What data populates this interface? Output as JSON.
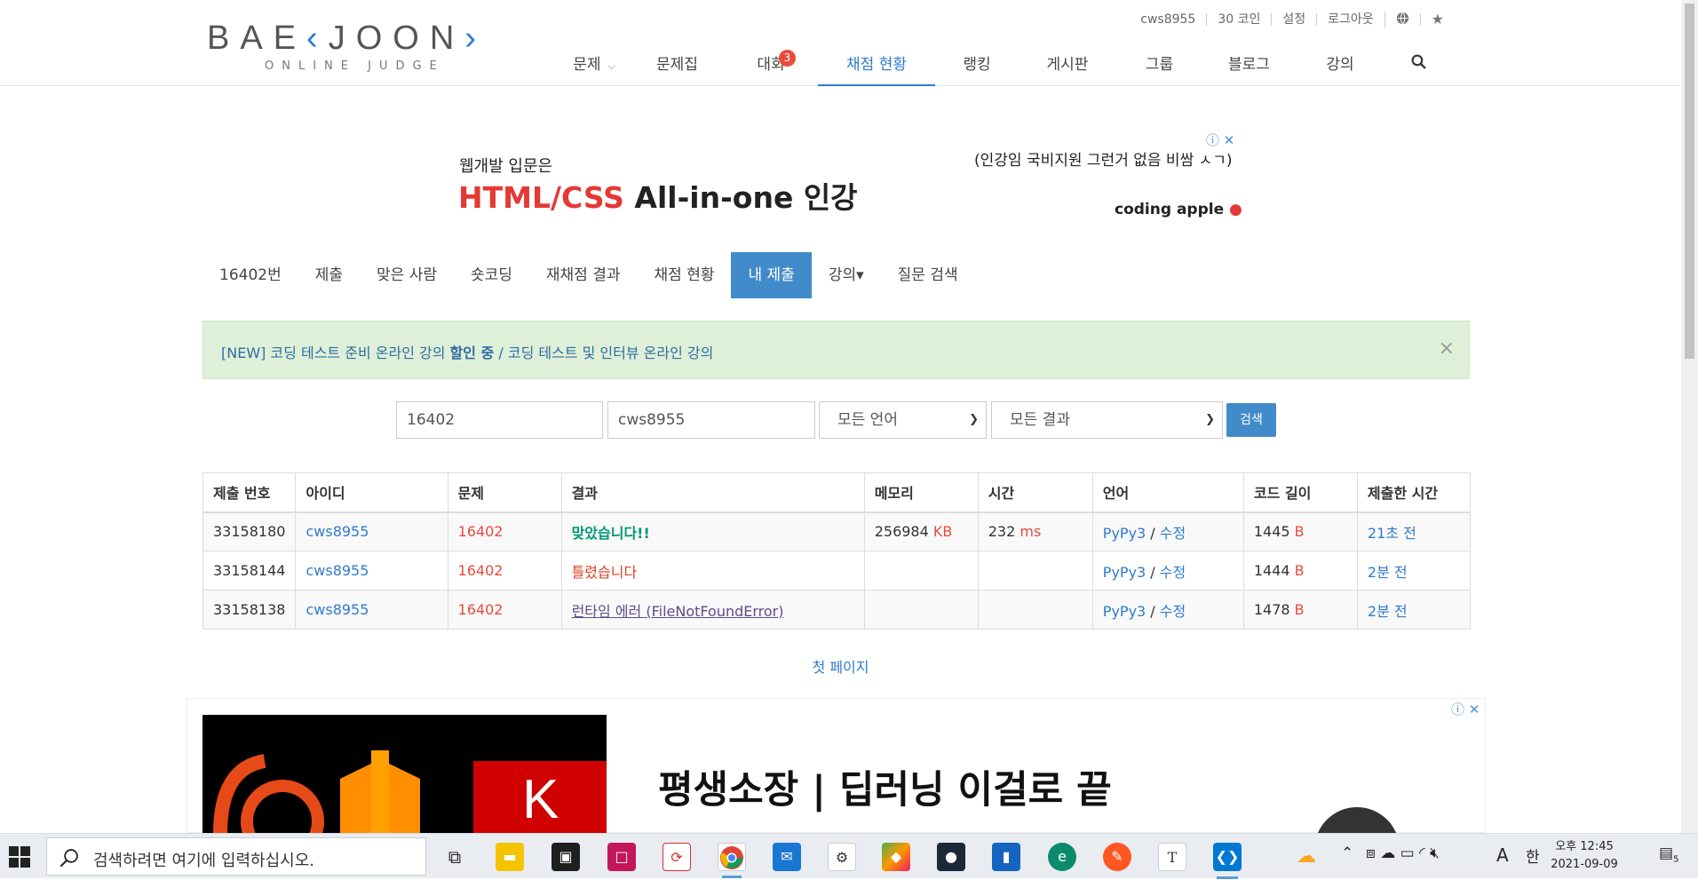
{
  "header": {
    "logo_main_a": "BAE",
    "logo_main_b": "K",
    "logo_main_c": "JOON",
    "logo_sub": "ONLINE JUDGE",
    "toplinks": [
      "cws8955",
      "30 코인",
      "설정",
      "로그아웃"
    ],
    "nav": [
      "문제",
      "문제집",
      "대회",
      "채점 현황",
      "랭킹",
      "게시판",
      "그룹",
      "블로그",
      "강의"
    ],
    "contest_badge": "3",
    "active_nav": "채점 현황"
  },
  "ad_top": {
    "small": "웹개발 입문은",
    "big_red": "HTML/CSS",
    "big_rest": " All-in-one 인강",
    "right": "(인강임 국비지원 그런거 없음 비쌈 ㅅㄱ)",
    "brand": "coding apple"
  },
  "subnav": [
    "16402번",
    "제출",
    "맞은 사람",
    "숏코딩",
    "재채점 결과",
    "채점 현황",
    "내 제출",
    "강의▾",
    "질문 검색"
  ],
  "alert": {
    "text_a": "[NEW] 코딩 테스트 준비 온라인 강의 ",
    "text_b": "할인 중",
    "text_c": " / 코딩 테스트 및 인터뷰 온라인 강의",
    "close": "×"
  },
  "search": {
    "problem": "16402",
    "user": "cws8955",
    "language": "모든 언어",
    "result": "모든 결과",
    "button": "검색"
  },
  "table": {
    "headers": [
      "제출 번호",
      "아이디",
      "문제",
      "결과",
      "메모리",
      "시간",
      "언어",
      "코드 길이",
      "제출한 시간"
    ],
    "rows": [
      {
        "id": "33158180",
        "user": "cws8955",
        "problem": "16402",
        "result": "맞았습니다!!",
        "memory": "256984",
        "memory_unit": "KB",
        "time": "232",
        "time_unit": "ms",
        "lang": "PyPy3",
        "edit": "수정",
        "length": "1445",
        "length_unit": "B",
        "submitted": "21초 전"
      },
      {
        "id": "33158144",
        "user": "cws8955",
        "problem": "16402",
        "result": "틀렸습니다",
        "memory": "",
        "memory_unit": "",
        "time": "",
        "time_unit": "",
        "lang": "PyPy3",
        "edit": "수정",
        "length": "1444",
        "length_unit": "B",
        "submitted": "2분 전"
      },
      {
        "id": "33158138",
        "user": "cws8955",
        "problem": "16402",
        "result": "런타임 에러 (FileNotFoundError)",
        "memory": "",
        "memory_unit": "",
        "time": "",
        "time_unit": "",
        "lang": "PyPy3",
        "edit": "수정",
        "length": "1478",
        "length_unit": "B",
        "submitted": "2분 전"
      }
    ]
  },
  "first_page": "첫 페이지",
  "ad_bottom": {
    "headline": "평생소장 | 딥러닝 이걸로 끝",
    "k_letter": "K"
  },
  "taskbar": {
    "search_placeholder": "검색하려면 여기에 입력하십시오.",
    "time": "오후 12:45",
    "date": "2021-09-09",
    "ime": "한",
    "ime_a": "A",
    "notif_count": "5"
  }
}
